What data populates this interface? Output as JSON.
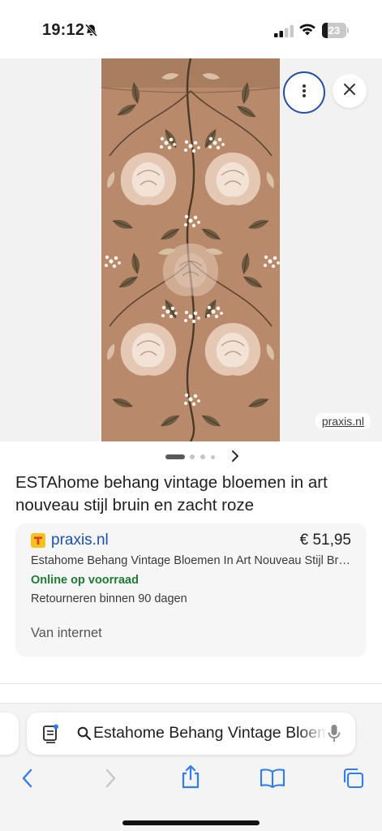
{
  "status_bar": {
    "time": "19:12",
    "battery_level": "23",
    "battery_fraction": 0.23,
    "icons": [
      "bell-slash-icon",
      "signal-bars-icon",
      "wifi-icon",
      "battery-icon"
    ]
  },
  "image_viewer": {
    "source_label": "praxis.nl",
    "more_icon": "more-vertical-icon",
    "close_icon": "close-icon",
    "pager": {
      "total": 4,
      "active": 1,
      "next_icon": "chevron-right-icon"
    }
  },
  "product": {
    "title": "ESTAhome behang vintage bloemen in art nouveau stijl bruin en zacht roze"
  },
  "offer": {
    "store_icon": "store-logo-icon",
    "store_name": "praxis.nl",
    "price": "€ 51,95",
    "product_name": "Estahome Behang Vintage Bloemen In Art Nouveau Stijl Bruin en Zacht Roze",
    "stock": "Online op voorraad",
    "returns": "Retourneren binnen 90 dagen",
    "via": "Van internet"
  },
  "browser": {
    "address_text": "Estahome Behang Vintage Bloemen",
    "icons": [
      "tabs-overview-icon",
      "search-icon",
      "microphone-icon",
      "back-icon",
      "forward-icon",
      "share-icon",
      "bookmarks-icon",
      "tabs-icon"
    ]
  },
  "colors": {
    "accent_blue": "#1a4fb4",
    "stock_green": "#1e7b34",
    "wallpaper_base": "#b8896a",
    "store_yellow": "#f4c21a",
    "ios_blue": "#2f7cf6"
  }
}
